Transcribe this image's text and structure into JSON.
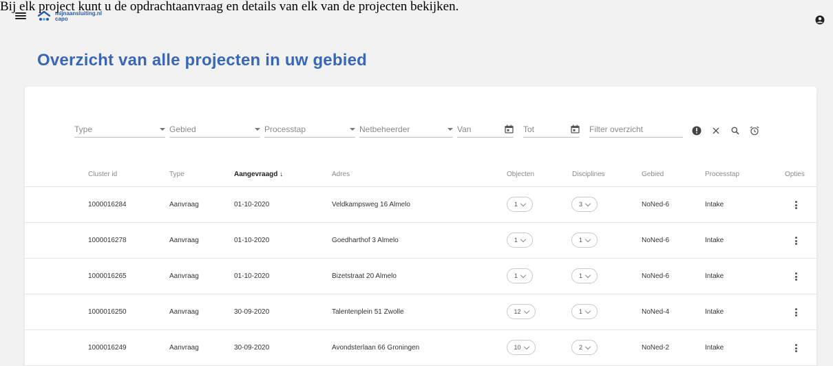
{
  "caption": "Bij elk project kunt u de opdrachtaanvraag en details van elk van de projecten bekijken.",
  "app": {
    "brand_line1": "mijnaansluiting.nl",
    "brand_line2": "capo"
  },
  "icons": {
    "menu": "hamburger-icon",
    "user": "user-circle-icon",
    "calendar": "calendar-icon",
    "info": "info-icon",
    "clear": "close-icon",
    "search": "search-icon",
    "alarm": "alarm-clock-icon",
    "row_menu": "more-vertical-icon",
    "chip_dropdown": "chevron-down-icon"
  },
  "page": {
    "title": "Overzicht van alle projecten in uw gebied"
  },
  "filters": {
    "type": "Type",
    "gebied": "Gebied",
    "processtap": "Processtap",
    "netbeheerder": "Netbeheerder",
    "van": "Van",
    "tot": "Tot",
    "filter_overzicht": "Filter overzicht"
  },
  "table": {
    "headers": {
      "cluster_id": "Cluster id",
      "type": "Type",
      "aangevraagd": "Aangevraagd ↓",
      "adres": "Adres",
      "objecten": "Objecten",
      "disciplines": "Disciplines",
      "gebied": "Gebied",
      "processtap": "Processtap",
      "opties": "Opties"
    },
    "rows": [
      {
        "cluster_id": "1000016284",
        "type": "Aanvraag",
        "aangevraagd": "01-10-2020",
        "adres": "Veldkampsweg 16 Almelo",
        "objecten": "1",
        "disciplines": "3",
        "gebied": "NoNed-6",
        "processtap": "Intake"
      },
      {
        "cluster_id": "1000016278",
        "type": "Aanvraag",
        "aangevraagd": "01-10-2020",
        "adres": "Goedharthof 3 Almelo",
        "objecten": "1",
        "disciplines": "1",
        "gebied": "NoNed-6",
        "processtap": "Intake"
      },
      {
        "cluster_id": "1000016265",
        "type": "Aanvraag",
        "aangevraagd": "01-10-2020",
        "adres": "Bizetstraat 20 Almelo",
        "objecten": "1",
        "disciplines": "1",
        "gebied": "NoNed-6",
        "processtap": "Intake"
      },
      {
        "cluster_id": "1000016250",
        "type": "Aanvraag",
        "aangevraagd": "30-09-2020",
        "adres": "Talentenplein 51 Zwolle",
        "objecten": "12",
        "disciplines": "1",
        "gebied": "NoNed-4",
        "processtap": "Intake"
      },
      {
        "cluster_id": "1000016249",
        "type": "Aanvraag",
        "aangevraagd": "30-09-2020",
        "adres": "Avondsterlaan 66 Groningen",
        "objecten": "10",
        "disciplines": "2",
        "gebied": "NoNed-2",
        "processtap": "Intake"
      }
    ]
  },
  "colors": {
    "accent": "#3a67b5",
    "background": "#f2f2f2"
  }
}
